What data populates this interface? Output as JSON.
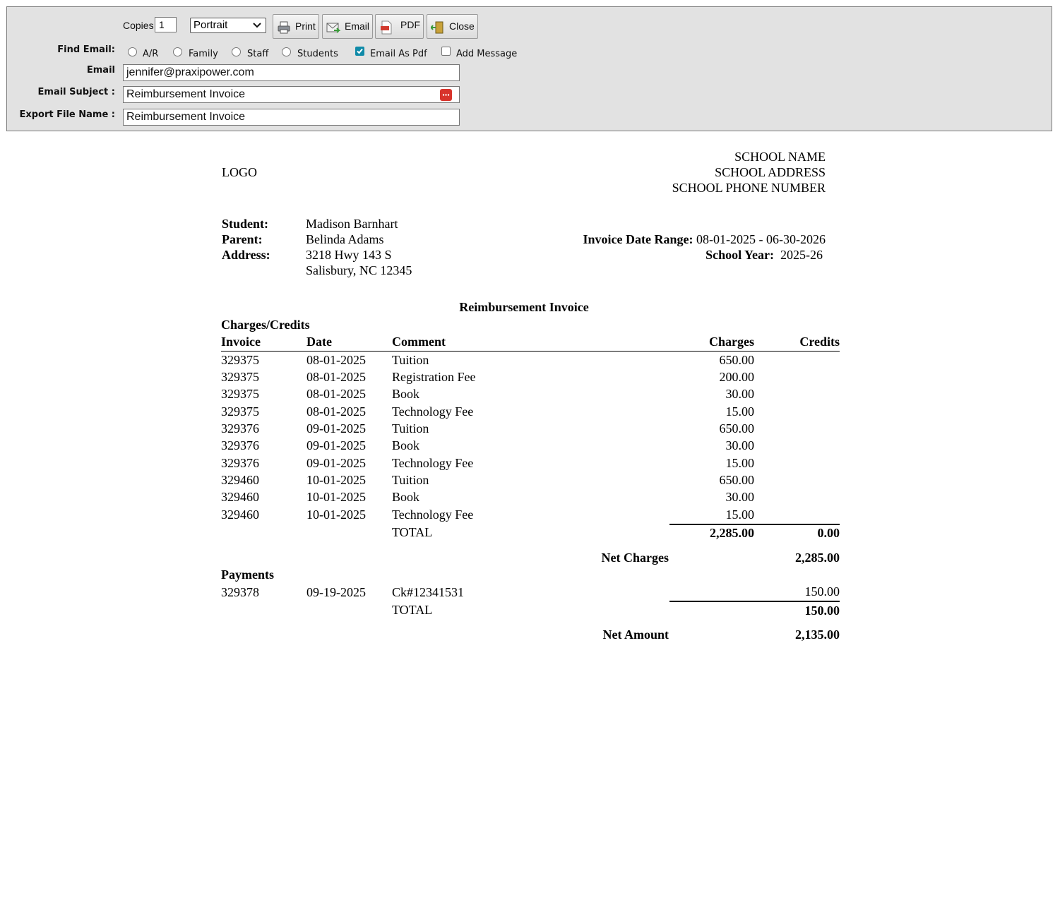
{
  "toolbar": {
    "copies_label": "Copies",
    "copies_value": "1",
    "orientation": "Portrait",
    "print_label": "Print",
    "email_label": "Email",
    "pdf_label": "PDF",
    "close_label": "Close"
  },
  "find_email": {
    "label": "Find Email:",
    "options": [
      {
        "label": "A/R",
        "checked": false
      },
      {
        "label": "Family",
        "checked": false
      },
      {
        "label": "Staff",
        "checked": false
      },
      {
        "label": "Students",
        "checked": false
      }
    ],
    "email_as_pdf": {
      "label": "Email As Pdf",
      "checked": true
    },
    "add_message": {
      "label": "Add Message",
      "checked": false
    }
  },
  "fields": {
    "email_label": "Email",
    "email_value": "jennifer@praxipower.com",
    "subject_label": "Email Subject :",
    "subject_value": "Reimbursement Invoice",
    "export_label": "Export File Name :",
    "export_value": "Reimbursement Invoice"
  },
  "school": {
    "logo": "LOGO",
    "name": "SCHOOL NAME",
    "address": "SCHOOL ADDRESS",
    "phone": "SCHOOL PHONE NUMBER"
  },
  "info": {
    "student_label": "Student:",
    "student": "Madison Barnhart",
    "parent_label": "Parent:",
    "parent": "Belinda Adams",
    "address_label": "Address:",
    "address_line1": "3218 Hwy 143 S",
    "address_line2": "Salisbury, NC 12345",
    "date_range_label": "Invoice Date Range:",
    "date_range": "08-01-2025 - 06-30-2026",
    "school_year_label": "School Year:",
    "school_year": "2025-26"
  },
  "invoice": {
    "title": "Reimbursement Invoice",
    "charges_heading": "Charges/Credits",
    "columns": {
      "invoice": "Invoice",
      "date": "Date",
      "comment": "Comment",
      "charges": "Charges",
      "credits": "Credits"
    },
    "rows": [
      {
        "invoice": "329375",
        "date": "08-01-2025",
        "comment": "Tuition",
        "charges": "650.00"
      },
      {
        "invoice": "329375",
        "date": "08-01-2025",
        "comment": "Registration Fee",
        "charges": "200.00"
      },
      {
        "invoice": "329375",
        "date": "08-01-2025",
        "comment": "Book",
        "charges": "30.00"
      },
      {
        "invoice": "329375",
        "date": "08-01-2025",
        "comment": "Technology Fee",
        "charges": "15.00"
      },
      {
        "invoice": "329376",
        "date": "09-01-2025",
        "comment": "Tuition",
        "charges": "650.00"
      },
      {
        "invoice": "329376",
        "date": "09-01-2025",
        "comment": "Book",
        "charges": "30.00"
      },
      {
        "invoice": "329376",
        "date": "09-01-2025",
        "comment": "Technology Fee",
        "charges": "15.00"
      },
      {
        "invoice": "329460",
        "date": "10-01-2025",
        "comment": "Tuition",
        "charges": "650.00"
      },
      {
        "invoice": "329460",
        "date": "10-01-2025",
        "comment": "Book",
        "charges": "30.00"
      },
      {
        "invoice": "329460",
        "date": "10-01-2025",
        "comment": "Technology Fee",
        "charges": "15.00"
      }
    ],
    "total_label": "TOTAL",
    "total_charges": "2,285.00",
    "total_credits": "0.00",
    "net_charges_label": "Net Charges",
    "net_charges": "2,285.00",
    "payments_heading": "Payments",
    "payments": [
      {
        "invoice": "329378",
        "date": "09-19-2025",
        "comment": "Ck#12341531",
        "amount": "150.00"
      }
    ],
    "payments_total_label": "TOTAL",
    "payments_total": "150.00",
    "net_amount_label": "Net Amount",
    "net_amount": "2,135.00"
  }
}
